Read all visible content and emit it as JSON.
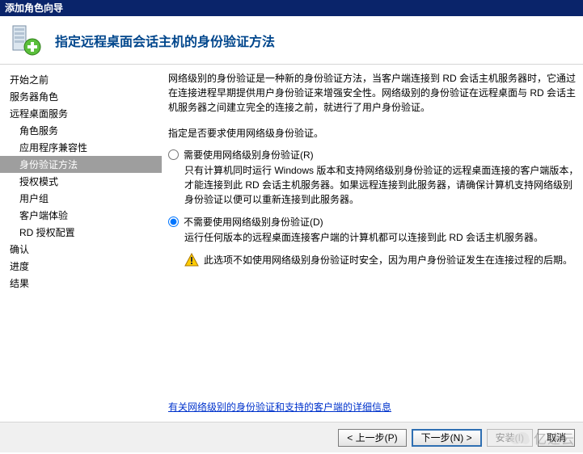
{
  "window": {
    "title": "添加角色向导"
  },
  "header": {
    "title": "指定远程桌面会话主机的身份验证方法"
  },
  "sidebar": {
    "items": [
      {
        "label": "开始之前",
        "child": false
      },
      {
        "label": "服务器角色",
        "child": false
      },
      {
        "label": "远程桌面服务",
        "child": false
      },
      {
        "label": "角色服务",
        "child": true
      },
      {
        "label": "应用程序兼容性",
        "child": true
      },
      {
        "label": "身份验证方法",
        "child": true,
        "selected": true
      },
      {
        "label": "授权模式",
        "child": true
      },
      {
        "label": "用户组",
        "child": true
      },
      {
        "label": "客户端体验",
        "child": true
      },
      {
        "label": "RD 授权配置",
        "child": true
      },
      {
        "label": "确认",
        "child": false
      },
      {
        "label": "进度",
        "child": false
      },
      {
        "label": "结果",
        "child": false
      }
    ]
  },
  "content": {
    "intro": "网络级别的身份验证是一种新的身份验证方法，当客户端连接到 RD 会话主机服务器时，它通过在连接进程早期提供用户身份验证来增强安全性。网络级别的身份验证在远程桌面与 RD 会话主机服务器之间建立完全的连接之前，就进行了用户身份验证。",
    "instruction": "指定是否要求使用网络级身份验证。",
    "options": [
      {
        "id": "require",
        "label": "需要使用网络级别身份验证(R)",
        "checked": false,
        "sub": "只有计算机同时运行 Windows 版本和支持网络级别身份验证的远程桌面连接的客户端版本，才能连接到此 RD 会话主机服务器。如果远程连接到此服务器，请确保计算机支持网络级别身份验证以便可以重新连接到此服务器。"
      },
      {
        "id": "norequire",
        "label": "不需要使用网络级别身份验证(D)",
        "checked": true,
        "sub": "运行任何版本的远程桌面连接客户端的计算机都可以连接到此 RD 会话主机服务器。",
        "warning": "此选项不如使用网络级别身份验证时安全，因为用户身份验证发生在连接过程的后期。"
      }
    ],
    "link": "有关网络级别的身份验证和支持的客户端的详细信息"
  },
  "footer": {
    "prev": "< 上一步(P)",
    "next": "下一步(N) >",
    "install": "安装(I)",
    "cancel": "取消"
  },
  "watermark": "亿速云"
}
